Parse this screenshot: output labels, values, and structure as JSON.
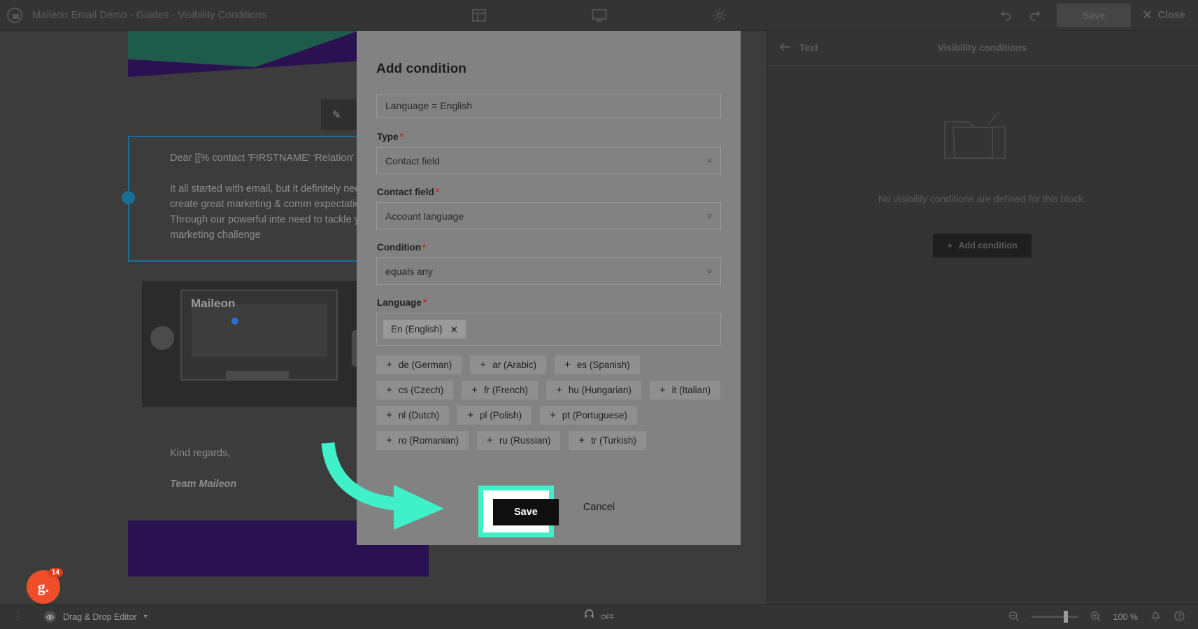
{
  "topbar": {
    "logo_icon": "maileon-logo-icon",
    "title": "Maileon Email Demo - Guides - Visibility Conditions",
    "center_icons": [
      "layout-grid-icon",
      "desktop-preview-icon",
      "settings-gear-icon"
    ],
    "undo_icon": "undo-icon",
    "redo_icon": "redo-icon",
    "save_label": "Save",
    "close_label": "Close",
    "close_icon": "close-x-icon"
  },
  "canvas": {
    "edit_icon": "pencil-edit-icon",
    "more_icon": "more-options-icon",
    "paragraph_1": "Dear [[% contact 'FIRSTNAME' 'Relation'",
    "paragraph_2": "It all started with email, but it definitely need to create great marketing & comm expectations. Through our powerful inte need to tackle your marketing challenge",
    "sign_off": "Kind regards,",
    "team": "Team Maileon",
    "image_brand": "Maileon"
  },
  "right_panel": {
    "back_icon": "arrow-left-icon",
    "back_label": "Text",
    "title": "Visibility conditions",
    "empty_icon": "empty-folder-icon",
    "empty_text": "No visibility conditions are defined for this block.",
    "add_condition_label": "Add condition",
    "add_condition_icon": "plus-icon"
  },
  "modal": {
    "heading": "Add condition",
    "name_value": "Language = English",
    "fields": [
      {
        "label": "Type",
        "required": "*",
        "value": "Contact field",
        "chevron": "chevron-down-icon"
      },
      {
        "label": "Contact field",
        "required": "*",
        "value": "Account language",
        "chevron": "chevron-down-icon"
      },
      {
        "label": "Condition",
        "required": "*",
        "value": "equals any",
        "chevron": "chevron-down-icon"
      }
    ],
    "language_label": "Language",
    "language_required": "*",
    "selected_languages": [
      {
        "label": "En (English)",
        "remove_icon": "remove-x-icon"
      }
    ],
    "available_languages": [
      "de (German)",
      "ar (Arabic)",
      "es (Spanish)",
      "cs (Czech)",
      "fr (French)",
      "hu (Hungarian)",
      "it (Italian)",
      "nl (Dutch)",
      "pl (Polish)",
      "pt (Portuguese)",
      "ro (Romanian)",
      "ru (Russian)",
      "tr (Turkish)"
    ],
    "add_tag_icon": "plus-icon",
    "save_label": "Save",
    "cancel_label": "Cancel"
  },
  "bottombar": {
    "kebab_icon": "vertical-dots-icon",
    "editor_icon": "eye-icon",
    "editor_label": "Drag & Drop Editor",
    "editor_caret": "chevron-down-icon",
    "center_icon": "magnet-icon",
    "center_tag": "OFF",
    "zoom_out_icon": "zoom-out-icon",
    "zoom_in_icon": "zoom-in-icon",
    "zoom_value": "100 %",
    "bell_icon": "bell-icon",
    "help_icon": "help-circle-icon"
  },
  "overlay": {
    "badge_letter": "g.",
    "badge_count": "14",
    "highlight_color": "#3ff0c8"
  }
}
